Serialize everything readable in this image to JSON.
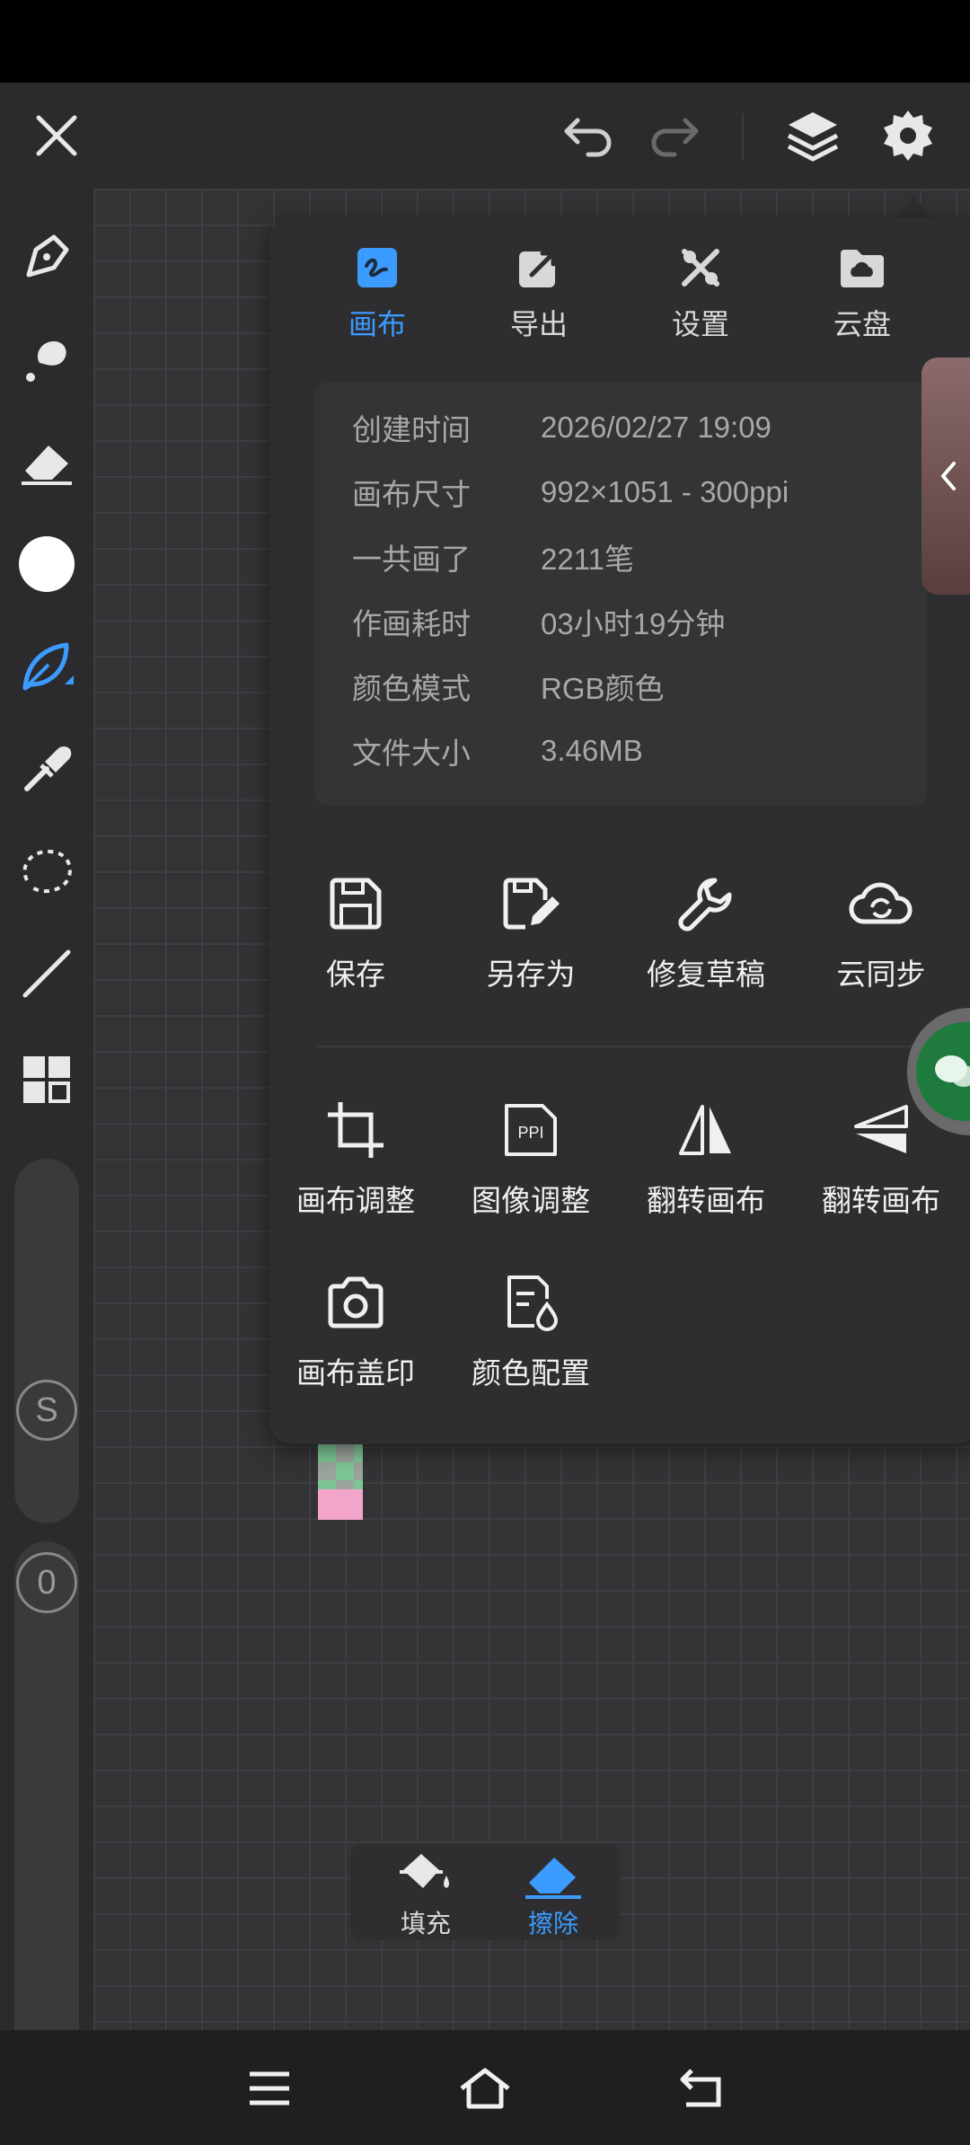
{
  "colors": {
    "accent": "#3b9bff",
    "panel": "#2e2e30",
    "toolbar": "#2b2b2d"
  },
  "top_bar": {
    "icons": [
      "close-icon",
      "undo-icon",
      "redo-icon",
      "layers-icon",
      "gear-icon"
    ]
  },
  "left_tools": [
    "pen-icon",
    "smudge-icon",
    "eraser-icon",
    "color-swatch",
    "leaf-brush-icon",
    "eyedropper-icon",
    "lasso-icon",
    "line-icon",
    "grid-icon"
  ],
  "badges": {
    "size_badge": "S",
    "opacity_badge": "0"
  },
  "panel": {
    "tabs": [
      {
        "label": "画布",
        "icon": "canvas-icon",
        "active": true
      },
      {
        "label": "导出",
        "icon": "export-icon",
        "active": false
      },
      {
        "label": "设置",
        "icon": "tools-icon",
        "active": false
      },
      {
        "label": "云盘",
        "icon": "cloud-folder-icon",
        "active": false
      }
    ],
    "info": [
      {
        "key": "创建时间",
        "value": "2026/02/27 19:09"
      },
      {
        "key": "画布尺寸",
        "value": "992×1051 - 300ppi"
      },
      {
        "key": "一共画了",
        "value": "2211笔"
      },
      {
        "key": "作画耗时",
        "value": "03小时19分钟"
      },
      {
        "key": "颜色模式",
        "value": "RGB颜色"
      },
      {
        "key": "文件大小",
        "value": "3.46MB"
      }
    ],
    "actions_row1": [
      {
        "label": "保存",
        "icon": "save-icon"
      },
      {
        "label": "另存为",
        "icon": "save-as-icon"
      },
      {
        "label": "修复草稿",
        "icon": "wrench-icon"
      },
      {
        "label": "云同步",
        "icon": "cloud-sync-icon"
      }
    ],
    "actions_row2": [
      {
        "label": "画布调整",
        "icon": "crop-icon"
      },
      {
        "label": "图像调整",
        "icon": "ppi-icon",
        "icon_text": "PPI"
      },
      {
        "label": "翻转画布",
        "icon": "flip-horizontal-icon"
      },
      {
        "label": "翻转画布",
        "icon": "flip-vertical-icon"
      }
    ],
    "actions_row3": [
      {
        "label": "画布盖印",
        "icon": "camera-icon"
      },
      {
        "label": "颜色配置",
        "icon": "color-profile-icon"
      }
    ]
  },
  "fill_erase": {
    "fill_label": "填充",
    "erase_label": "擦除"
  },
  "nav": [
    "menu-icon",
    "home-icon",
    "back-icon"
  ]
}
